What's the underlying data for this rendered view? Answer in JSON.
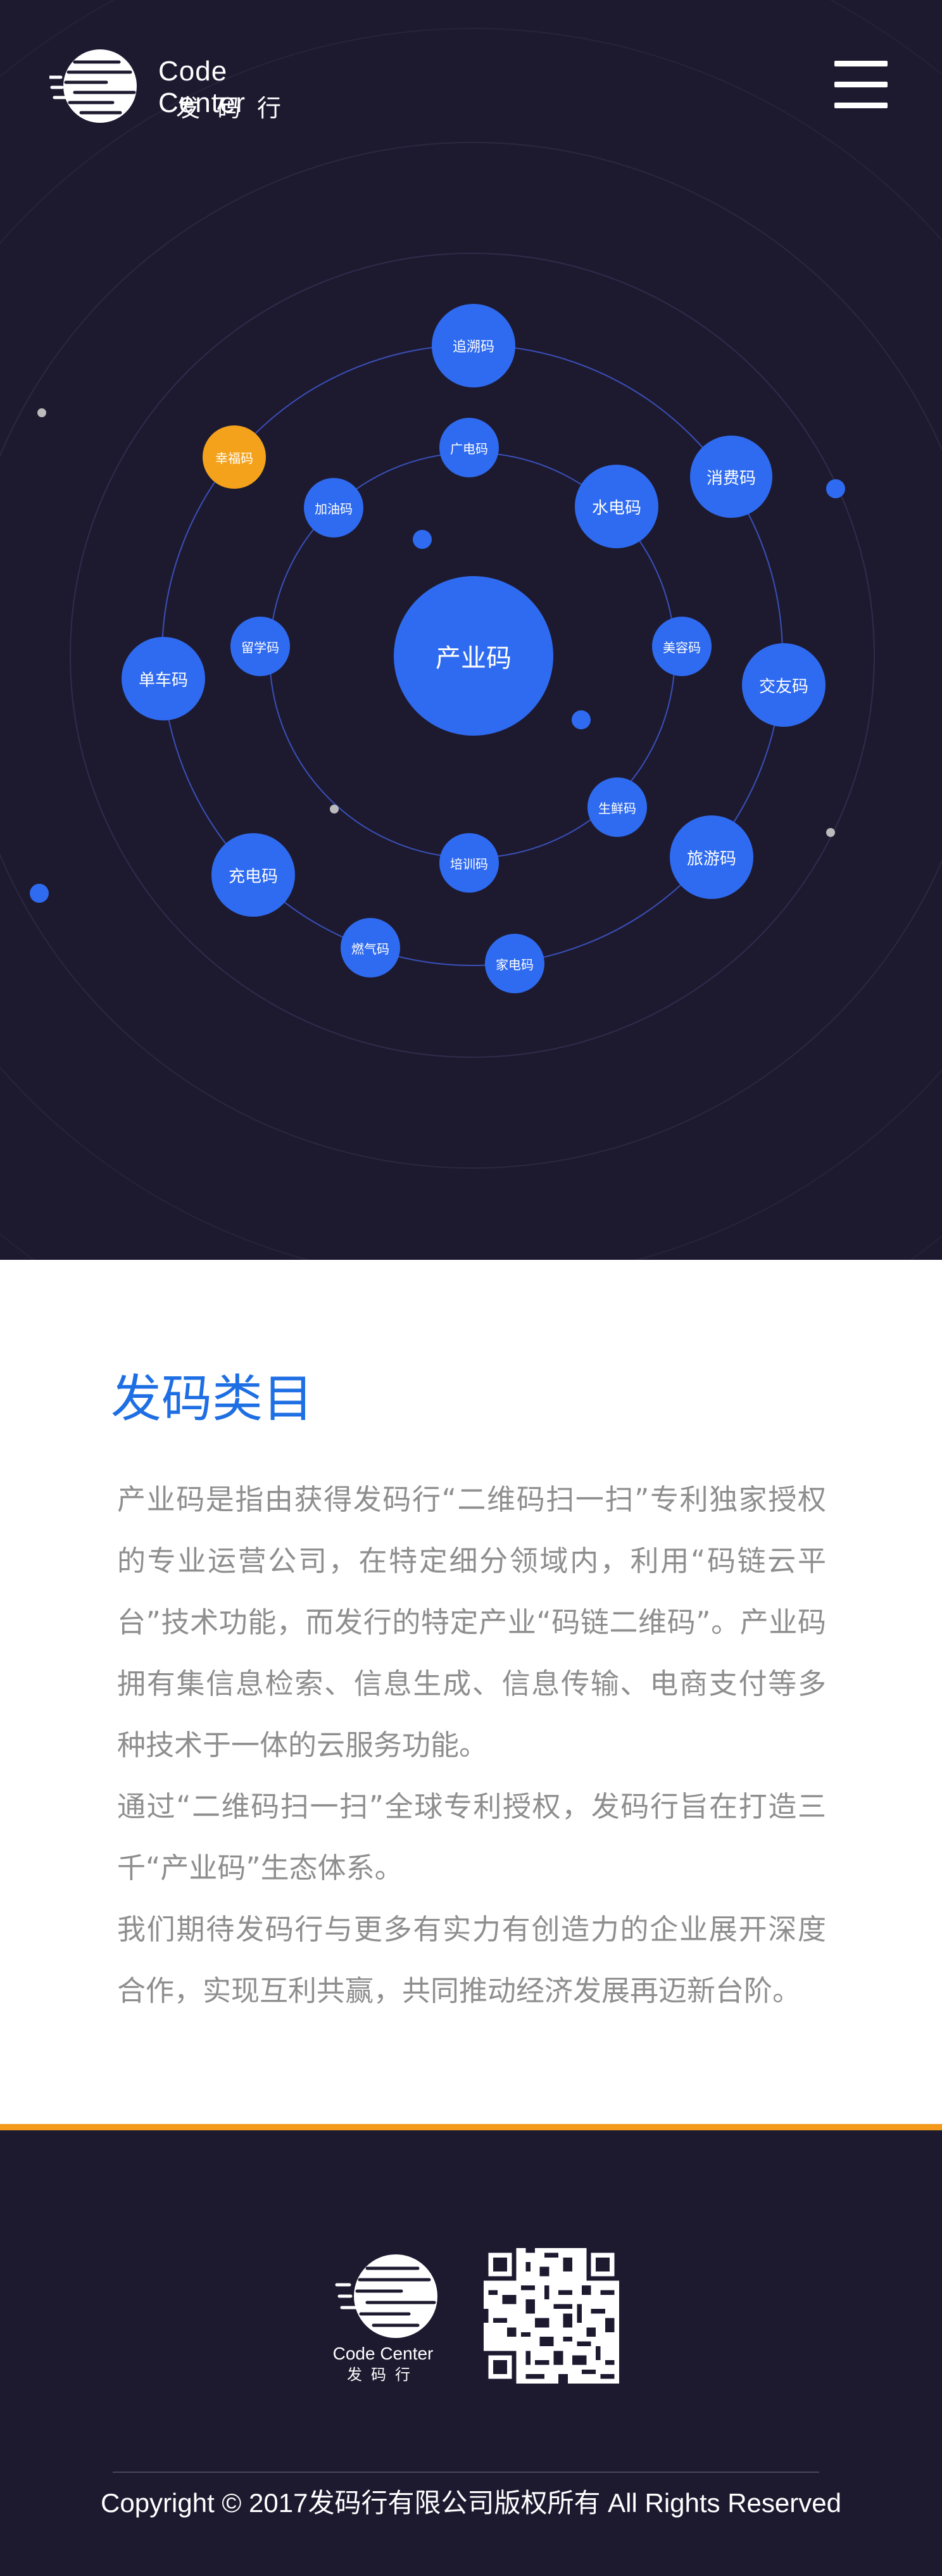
{
  "header": {
    "logo_en": "Code Center",
    "logo_cn": "发码行",
    "menu_icon": "hamburger-menu-icon"
  },
  "diagram": {
    "center": "产业码",
    "codes": [
      "追溯码",
      "广电码",
      "加油码",
      "幸福码",
      "水电码",
      "消费码",
      "留学码",
      "美容码",
      "单车码",
      "交友码",
      "生鲜码",
      "培训码",
      "充电码",
      "旅游码",
      "燃气码",
      "家电码"
    ]
  },
  "category": {
    "title": "发码类目",
    "paragraphs": [
      "产业码是指由获得发码行“二维码扫一扫”专利独家授权的专业运营公司，在特定细分领域内，利用“码链云平台”技术功能，而发行的特定产业“码链二维码”。产业码拥有集信息检索、信息生成、信息传输、电商支付等多种技术于一体的云服务功能。",
      "通过“二维码扫一扫”全球专利授权，发码行旨在打造三千“产业码”生态体系。",
      "我们期待发码行与更多有实力有创造力的企业展开深度合作，实现互利共赢，共同推动经济发展再迈新台阶。"
    ]
  },
  "footer": {
    "logo_en": "Code Center",
    "logo_cn": "发码行",
    "qr_icon": "qr-code",
    "copyright": "Copyright  ©  2017发码行有限公司版权所有 All Rights Reserved"
  },
  "colors": {
    "background_dark": "#1d1a30",
    "bubble_blue": "#2f6bf0",
    "bubble_orange": "#f4a21b",
    "title_blue": "#1e6fe3",
    "accent_orange": "#f39a1c"
  }
}
